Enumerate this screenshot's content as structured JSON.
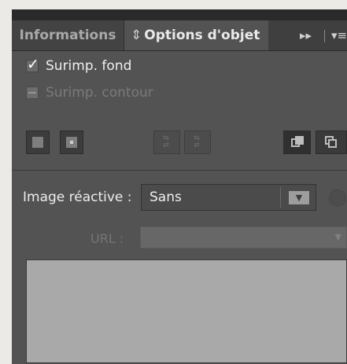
{
  "tabs": {
    "informations": "Informations",
    "options_icon": "⇕",
    "options": "Options d'objet",
    "expand_glyph": "▸▸",
    "menu_glyph": "▾≡"
  },
  "checkboxes": [
    {
      "label": "Surimp. fond",
      "state": "checked"
    },
    {
      "label": "Surimp. contour",
      "state": "mixed"
    }
  ],
  "icons": [
    "shape-button-icon",
    "centered-shape-button-icon",
    "horizontal-arrows-icon",
    "vertical-arrows-icon",
    "front-overlap-icon",
    "back-overlap-icon"
  ],
  "image_reactive": {
    "label": "Image réactive :",
    "value": "Sans",
    "arrow": "▼"
  },
  "url": {
    "label": "URL :",
    "value": "",
    "arrow": "▼"
  },
  "colors": {
    "panel": "#535353",
    "tab_active": "#535353",
    "tab_inactive": "#434343",
    "textarea": "#a9a9a9"
  }
}
